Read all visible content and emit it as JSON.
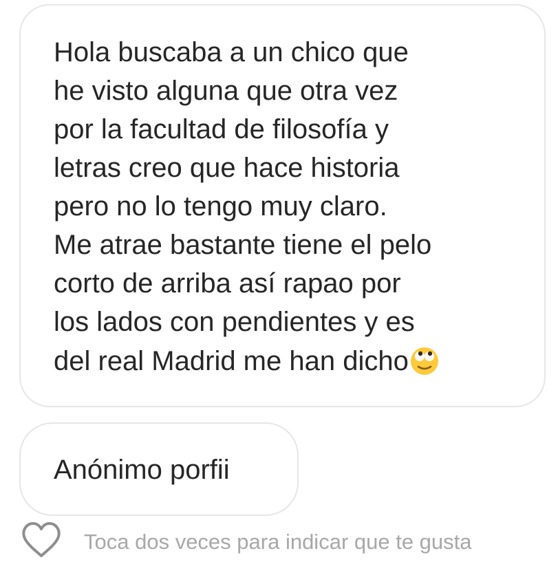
{
  "message": {
    "lines": [
      "Hola buscaba a un chico que",
      "he visto alguna que otra vez",
      "por la facultad de filosofía y",
      "letras creo que hace historia",
      "pero no lo tengo muy claro.",
      "Me atrae bastante tiene el pelo",
      "corto de arriba así rapao por",
      "los lados con pendientes y es",
      "del real Madrid me han dicho"
    ],
    "emoji": "face-with-rolling-eyes-icon"
  },
  "second_message": {
    "text": "Anónimo porfii"
  },
  "footer": {
    "like_icon": "heart-outline-icon",
    "hint": "Toca dos veces para indicar que te gusta"
  },
  "colors": {
    "text": "#262626",
    "bubble_border": "#e6e6e6",
    "hint": "#a8a8a8",
    "heart_stroke": "#8e8e8e",
    "emoji_yellow": "#ffc93c"
  }
}
